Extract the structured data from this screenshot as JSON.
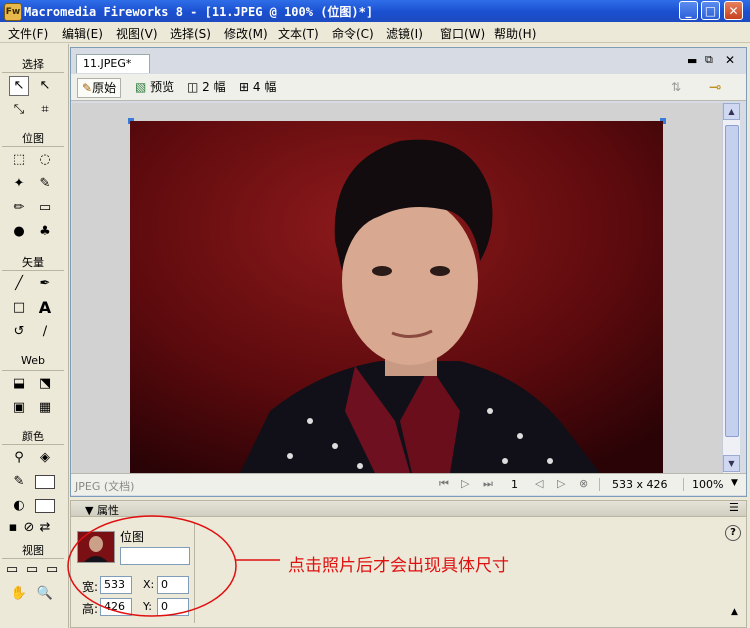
{
  "window": {
    "title": "Macromedia Fireworks 8 - [11.JPEG @ 100% (位图)*]",
    "app_icon": "Fw"
  },
  "menu": [
    "文件(F)",
    "编辑(E)",
    "视图(V)",
    "选择(S)",
    "修改(M)",
    "文本(T)",
    "命令(C)",
    "滤镜(I)",
    "窗口(W)",
    "帮助(H)"
  ],
  "tools": {
    "select_label": "选择",
    "bitmap_label": "位图",
    "vector_label": "矢量",
    "web_label": "Web",
    "color_label": "颜色",
    "view_label": "视图",
    "text_tool_glyph": "A"
  },
  "document": {
    "tab": "11.JPEG*",
    "views": {
      "original": "原始",
      "preview": "预览",
      "two_up": "2 幅",
      "four_up": "4 幅"
    },
    "status_left": "JPEG (文档)",
    "page_number": "1",
    "dimensions": "533 x 426",
    "zoom": "100%"
  },
  "properties": {
    "panel_title": "▼ 属性",
    "object_type": "位图",
    "name_value": "",
    "width_label": "宽:",
    "width_value": "533",
    "height_label": "高:",
    "height_value": "426",
    "x_label": "X:",
    "x_value": "0",
    "y_label": "Y:",
    "y_value": "0",
    "help": "?"
  },
  "annotation": "点击照片后才会出现具体尺寸",
  "colors": {
    "accent_titlebar": "#1a4fd0",
    "annotation": "#e01010",
    "photo_background": "#7a1014"
  }
}
